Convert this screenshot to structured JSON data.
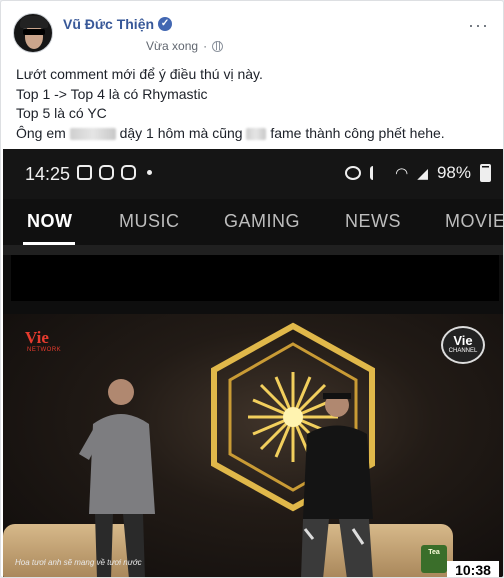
{
  "post": {
    "author": "Vũ Đức Thiện",
    "time": "Vừa xong",
    "more": "···",
    "lines": {
      "l1": "Lướt comment mới để ý điều thú vị này.",
      "l2": "Top 1 -> Top 4 là có Rhymastic",
      "l3": "Top 5 là có YC",
      "l4a": "Ông em",
      "l4b": "dậy 1 hôm mà cũng",
      "l4c": "fame thành công phết hehe."
    }
  },
  "phone": {
    "time": "14:25",
    "battery": "98%",
    "tabs": [
      "NOW",
      "MUSIC",
      "GAMING",
      "NEWS",
      "MOVIE"
    ]
  },
  "video": {
    "logo_left": "Vie",
    "logo_left_sub": "NETWORK",
    "logo_right": "Vie",
    "logo_right_sub": "CHANNEL",
    "caption": "Hoa tươi anh sẽ mang về tươi nước",
    "brand": "Tea",
    "timer": "10:38"
  },
  "colors": {
    "link": "#385898",
    "verified": "#4267b2"
  }
}
